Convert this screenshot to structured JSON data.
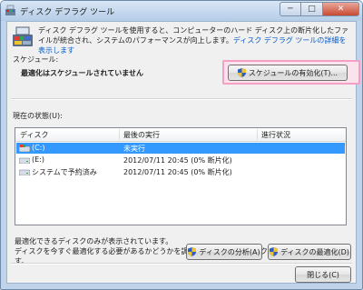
{
  "window": {
    "title": "ディスク デフラグ ツール",
    "minimize": "─",
    "maximize": "□",
    "close": "✕"
  },
  "intro": {
    "text": "ディスク デフラグ ツールを使用すると、コンピューターのハード ディスク上の断片化したファイルが統合され、システムのパフォーマンスが向上します。",
    "link": "ディスク デフラグ ツールの詳細を表示します"
  },
  "schedule": {
    "label": "スケジュール:",
    "status": "最適化はスケジュールされていません",
    "button": "スケジュールの有効化(T)..."
  },
  "current": {
    "label": "現在の状態(U):",
    "columns": [
      "ディスク",
      "最後の実行",
      "進行状況"
    ],
    "rows": [
      {
        "disk": "(C:)",
        "last_run": "未実行",
        "progress": "",
        "selected": true
      },
      {
        "disk": "(E:)",
        "last_run": "2012/07/11 20:45 (0% 断片化)",
        "progress": "",
        "selected": false
      },
      {
        "disk": "システムで予約済み",
        "last_run": "2012/07/11 20:45 (0% 断片化)",
        "progress": "",
        "selected": false
      }
    ]
  },
  "note": {
    "line1": "最適化できるディスクのみが表示されています。",
    "line2": "ディスクを今すぐ最適化する必要があるかどうかを調べるには、まずディスクを分析する必要があります。"
  },
  "buttons": {
    "analyze": "ディスクの分析(A)",
    "defrag": "ディスクの最適化(D)",
    "close": "閉じる(C)"
  },
  "colors": {
    "selection": "#3399ff",
    "highlight_border": "#f3a0c4",
    "link": "#0a5bc4"
  }
}
